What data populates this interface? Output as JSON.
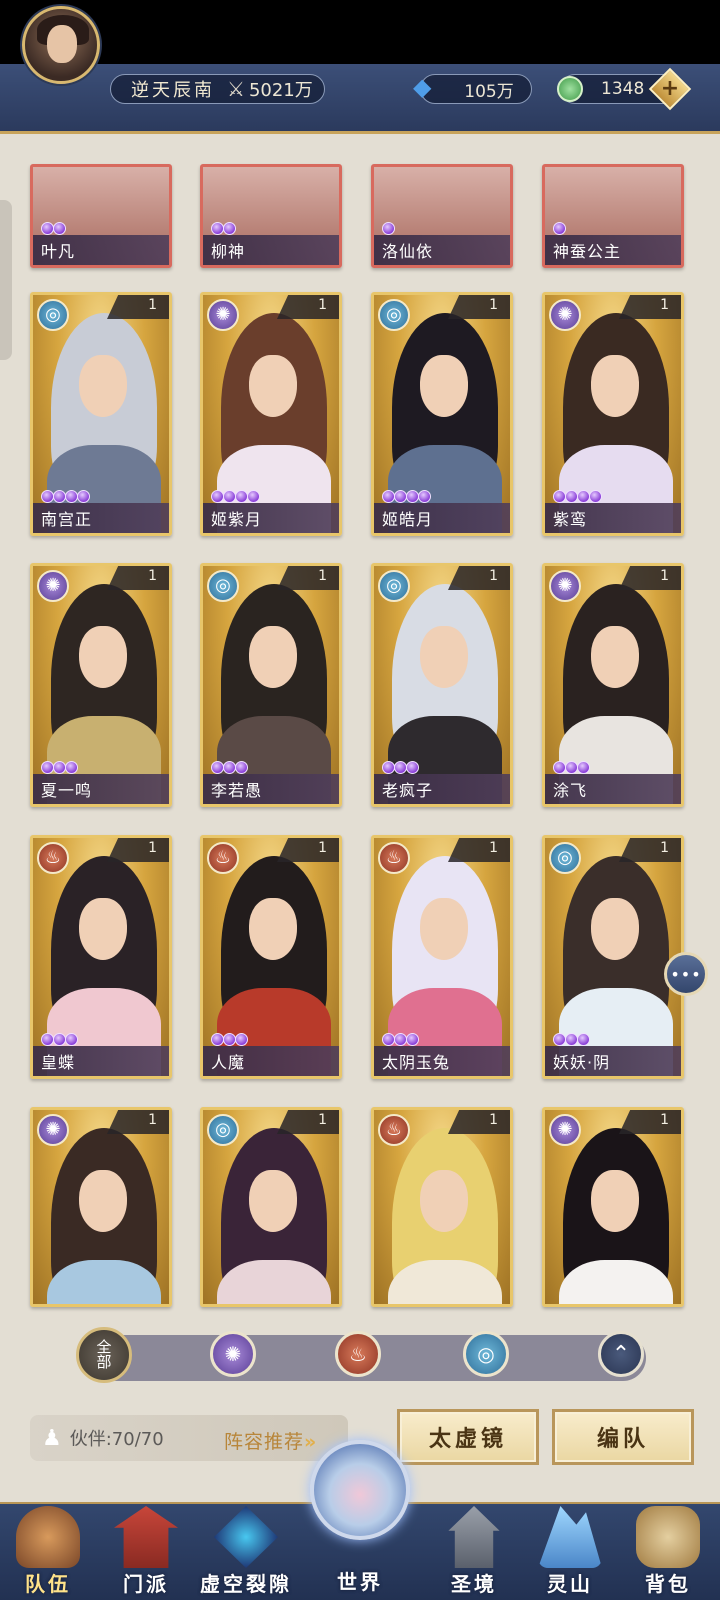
{
  "header": {
    "player_name": "逆天辰南",
    "power_value": "5021万",
    "jade_value": "105万",
    "coin_value": "1348",
    "add_symbol": "+"
  },
  "cards_top_row": [
    {
      "name": "叶凡",
      "stars": 2
    },
    {
      "name": "柳神",
      "stars": 2
    },
    {
      "name": "洛仙依",
      "stars": 1
    },
    {
      "name": "神蚕公主",
      "stars": 1
    }
  ],
  "cards": [
    {
      "name": "南宫正",
      "level": "1",
      "element": "water",
      "stars": 4
    },
    {
      "name": "姬紫月",
      "level": "1",
      "element": "wind",
      "stars": 4
    },
    {
      "name": "姬皓月",
      "level": "1",
      "element": "water",
      "stars": 4
    },
    {
      "name": "紫鸾",
      "level": "1",
      "element": "wind",
      "stars": 4
    },
    {
      "name": "夏一鸣",
      "level": "1",
      "element": "wind",
      "stars": 3
    },
    {
      "name": "李若愚",
      "level": "1",
      "element": "water",
      "stars": 3
    },
    {
      "name": "老疯子",
      "level": "1",
      "element": "water",
      "stars": 3
    },
    {
      "name": "涂飞",
      "level": "1",
      "element": "wind",
      "stars": 3
    },
    {
      "name": "皇蝶",
      "level": "1",
      "element": "fire",
      "stars": 3
    },
    {
      "name": "人魔",
      "level": "1",
      "element": "fire",
      "stars": 3
    },
    {
      "name": "太阴玉兔",
      "level": "1",
      "element": "fire",
      "stars": 3
    },
    {
      "name": "妖妖·阴",
      "level": "1",
      "element": "water",
      "stars": 3
    },
    {
      "name": "",
      "level": "1",
      "element": "wind",
      "stars": 0
    },
    {
      "name": "",
      "level": "1",
      "element": "water",
      "stars": 0
    },
    {
      "name": "",
      "level": "1",
      "element": "fire",
      "stars": 0
    },
    {
      "name": "",
      "level": "1",
      "element": "wind",
      "stars": 0
    }
  ],
  "filter": {
    "all_label_top": "全",
    "all_label_bottom": "部"
  },
  "footer": {
    "partner_label": "伙伴:70/70",
    "recommend_label": "阵容推荐",
    "mirror_button": "太虚镜",
    "team_button": "编队"
  },
  "nav": {
    "team": "队伍",
    "sect": "门派",
    "rift": "虚空裂隙",
    "world": "世界",
    "sacred": "圣境",
    "mount": "灵山",
    "bag": "背包"
  },
  "colors": {
    "accent_gold": "#e8c66a",
    "nav_blue": "#2b3a5d",
    "element_water": "#2f6f9a",
    "element_wind": "#5a3e96",
    "element_fire": "#8e3424"
  },
  "icons": {
    "water": "water-element-icon",
    "wind": "wind-element-icon",
    "fire": "fire-element-icon"
  }
}
